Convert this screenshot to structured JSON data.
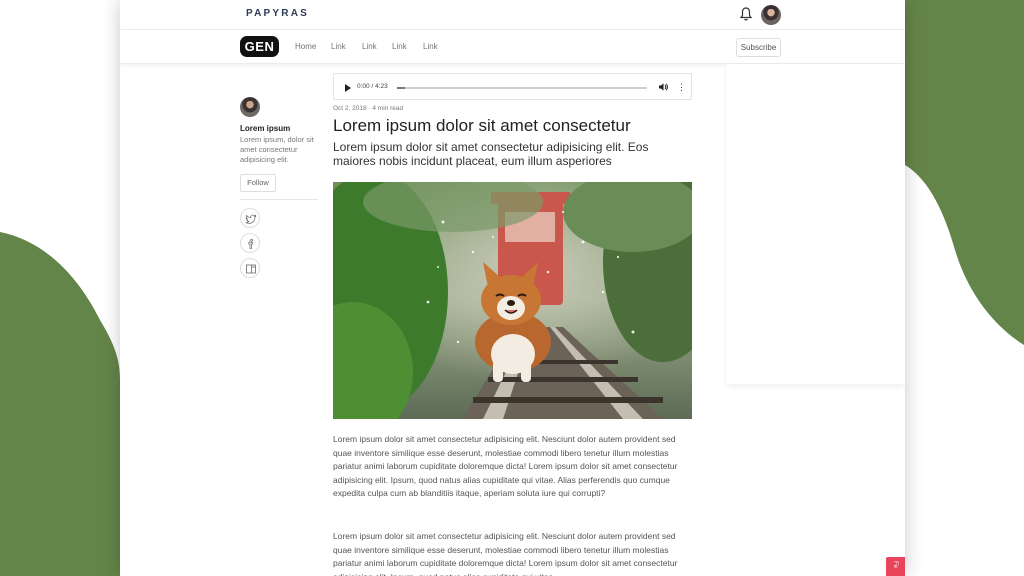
{
  "header": {
    "brand": "PAPYRAS",
    "bell_icon": "bell-icon",
    "avatar_icon": "user-avatar"
  },
  "nav": {
    "logo": "GEN",
    "links": [
      "Home",
      "Link",
      "Link",
      "Link",
      "Link"
    ],
    "subscribe_label": "Subscribe"
  },
  "author": {
    "name": "Lorem ipsum",
    "bio": "Lorem ipsum, dolor sit amet consectetur adipisicing elit.",
    "follow_label": "Follow",
    "share_icons": [
      "twitter-icon",
      "facebook-icon",
      "bookmark-icon"
    ]
  },
  "audio": {
    "time": "0:00 / 4:23",
    "progress": 0.03
  },
  "article": {
    "meta": "Oct 2, 2018 · 4 min read",
    "title": "Lorem ipsum dolor sit amet consectetur",
    "subtitle": "Lorem ipsum dolor sit amet consectetur adipisicing elit. Eos maiores nobis incidunt placeat, eum illum asperiores",
    "hero_image": "corgi on railway tracks",
    "paragraphs": [
      "Lorem ipsum dolor sit amet consectetur adipisicing elit. Nesciunt dolor autem provident sed quae inventore similique esse deserunt, molestiae commodi libero tenetur illum molestias pariatur animi laborum cupiditate doloremque dicta! Lorem ipsum dolor sit amet consectetur adipisicing elit. Ipsum, quod natus alias cupiditate qui vitae. Alias perferendis quo cumque expedita culpa cum ab blanditiis itaque, aperiam soluta iure qui corrupti?",
      "Lorem ipsum dolor sit amet consectetur adipisicing elit. Nesciunt dolor autem provident sed quae inventore similique esse deserunt, molestiae commodi libero tenetur illum molestias pariatur animi laborum cupiditate doloremque dicta! Lorem ipsum dolor sit amet consectetur adipisicing elit. Ipsum, quod natus alias cupiditate qui vitae."
    ]
  },
  "colors": {
    "background_blob": "#648549",
    "brand": "#2d3b55",
    "feedback_tab": "#e8445a"
  }
}
